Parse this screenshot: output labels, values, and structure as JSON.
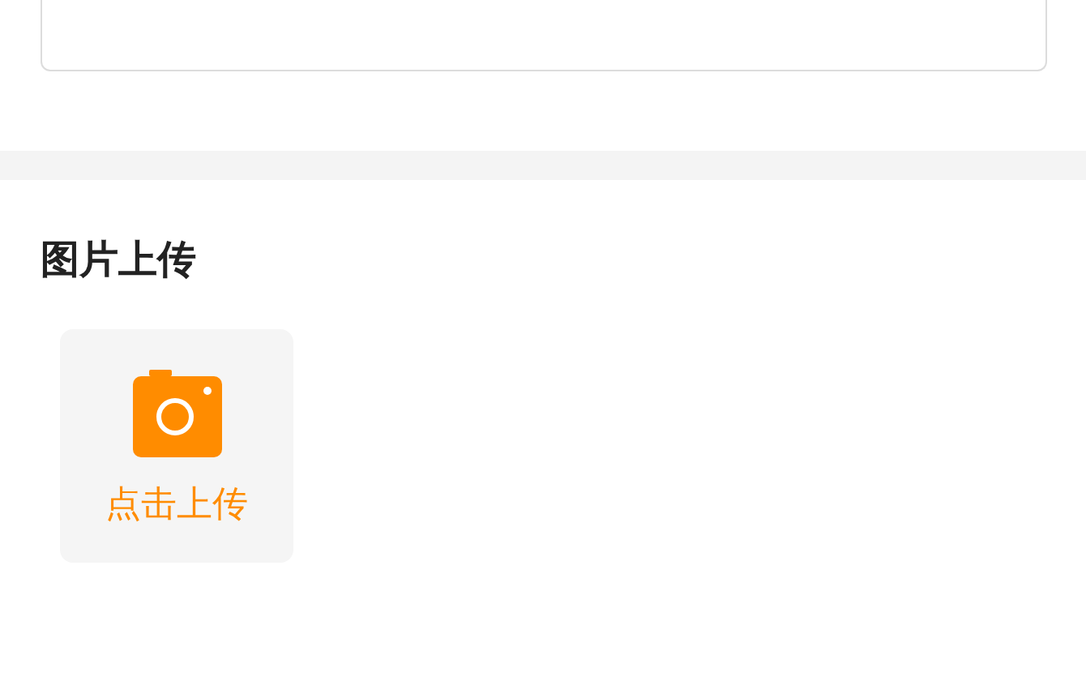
{
  "section": {
    "title": "图片上传"
  },
  "upload": {
    "label": "点击上传"
  }
}
